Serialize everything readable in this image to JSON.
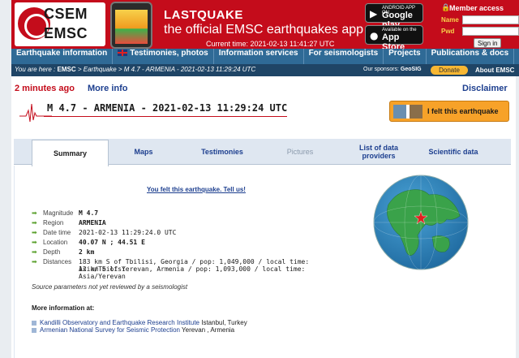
{
  "header": {
    "logo_line1": "CSEM",
    "logo_line2": "EMSC",
    "app_title": "LASTQUAKE",
    "app_subtitle": "the official EMSC earthquakes app",
    "current_time": "Current time: 2021-02-13 11:41:27 UTC",
    "google_small": "ANDROID APP ON",
    "google_big": "Google play",
    "apple_small": "Available on the",
    "apple_big": "App Store",
    "member_title": "Member access",
    "name_label": "Name",
    "pwd_label": "Pwd",
    "signin_label": "Sign in"
  },
  "nav": {
    "items": [
      "Earthquake information",
      "Testimonies, photos",
      "Information services",
      "For seismologists",
      "Projects",
      "Publications & docs"
    ]
  },
  "crumbbar": {
    "you_are_here": "You are here :",
    "crumb_emsc": "EMSC",
    "crumb_rest": " > Earthquake > M 4.7 - ARMENIA - 2021-02-13 11:29:24 UTC",
    "sponsors_label": "Our sponsors:",
    "sponsor": "GeoSIG",
    "donate": "Donate",
    "about": "About EMSC"
  },
  "event": {
    "ago": "2 minutes ago",
    "more_info": "More info",
    "disclaimer": "Disclaimer",
    "title": "M 4.7 - ARMENIA - 2021-02-13 11:29:24 UTC",
    "felt_button": "I felt this earthquake",
    "felt_link": "You felt this earthquake. Tell us!",
    "review_note": "Source parameters not yet reviewed by a seismologist",
    "more_info_heading": "More information at:"
  },
  "tabs": {
    "summary": "Summary",
    "maps": "Maps",
    "testimonies": "Testimonies",
    "pictures": "Pictures",
    "providers": "List of data providers",
    "scientific": "Scientific data"
  },
  "params": {
    "magnitude": {
      "label": "Magnitude",
      "value": "M 4.7"
    },
    "region": {
      "label": "Region",
      "value": "ARMENIA"
    },
    "datetime": {
      "label": "Date time",
      "value": "2021-02-13 11:29:24.0 UTC"
    },
    "location": {
      "label": "Location",
      "value": "40.07 N ; 44.51 E"
    },
    "depth": {
      "label": "Depth",
      "value": "2 km"
    },
    "distances": {
      "label": "Distances",
      "line1": "183 km S of Tbilisi, Georgia / pop: 1,049,000 / local time: Asia/Tbilisi",
      "line2": "12 km S of Yerevan, Armenia / pop: 1,093,000 / local time: Asia/Yerevan"
    }
  },
  "links": [
    {
      "name": "Kandilli Observatory and Earthquake Research Institute",
      "place": " Istanbul, Turkey"
    },
    {
      "name": "Armenian National Survey for Seismic Protection",
      "place": " Yerevan , Armenia"
    }
  ],
  "colors": {
    "brand_red": "#c40c1b",
    "nav_blue": "#2f6a96",
    "link_blue": "#1d3f8f",
    "accent_orange": "#f7a229"
  }
}
